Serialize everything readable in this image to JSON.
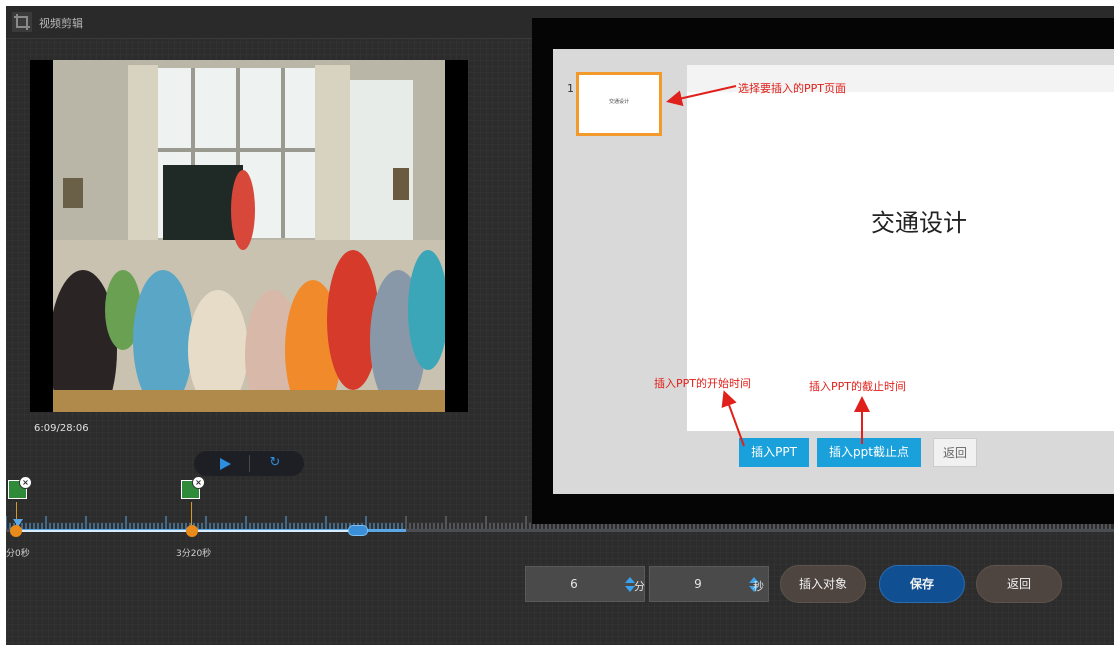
{
  "window": {
    "title": "视频剪辑",
    "title_icon": "crop-icon"
  },
  "player": {
    "timecode": "6:09/28:06",
    "play_icon": "play-icon",
    "reset_icon": "refresh-icon"
  },
  "timeline": {
    "markers": [
      {
        "icon": "image-marker-icon",
        "label": "分0秒"
      },
      {
        "icon": "image-marker-icon",
        "label": "3分20秒"
      }
    ],
    "progress": 0.31
  },
  "time_input": {
    "minutes": "6",
    "minutes_unit": "分",
    "seconds": "9",
    "seconds_unit": "秒"
  },
  "actions": {
    "insert_object": "插入对象",
    "save": "保存",
    "back": "返回"
  },
  "ppt_dialog": {
    "page_number": "1",
    "thumb_text": "交通设计",
    "slide_title": "交通设计",
    "buttons": {
      "insert_ppt": "插入PPT",
      "insert_cut": "插入ppt截止点",
      "back": "返回"
    }
  },
  "annotations": {
    "select_page": "选择要插入的PPT页面",
    "start_time": "插入PPT的开始时间",
    "end_time": "插入PPT的截止时间"
  },
  "colors": {
    "accent_blue": "#1aa0da",
    "save_blue": "#0f4f92",
    "highlight_orange": "#f39a2d",
    "annotation_red": "#e0201a"
  }
}
